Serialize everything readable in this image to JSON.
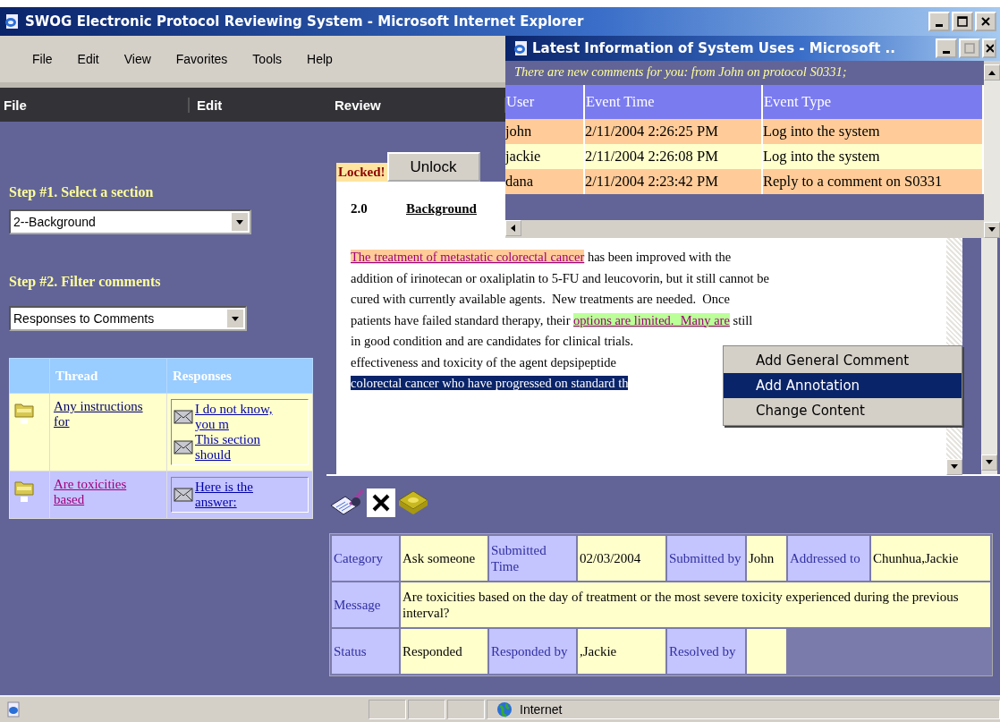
{
  "window": {
    "title": "SWOG Electronic Protocol Reviewing System - Microsoft Internet Explorer"
  },
  "menu_bar": [
    "File",
    "Edit",
    "View",
    "Favorites",
    "Tools",
    "Help"
  ],
  "app_menu": [
    "File",
    "Edit",
    "Review"
  ],
  "left_panel": {
    "step1_label": "Step #1. Select a section",
    "section_select": "2--Background",
    "step2_label": "Step #2. Filter comments",
    "filter_select": "Responses to Comments"
  },
  "thread_table": {
    "columns": [
      "Thread",
      "Responses"
    ],
    "rows": [
      {
        "thread": "Any instructions for",
        "selected": false,
        "responses": [
          "I do not know, you m",
          "This section should"
        ]
      },
      {
        "thread": "Are toxicities based",
        "selected": true,
        "responses": [
          "Here is the answer:"
        ]
      }
    ]
  },
  "document": {
    "lock_status": "Locked!",
    "unlock_button": "Unlock",
    "section_number": "2.0",
    "section_title": "Background",
    "lines": [
      [
        {
          "text": "The treatment of metastatic colorectal cancer",
          "kind": "annotation"
        },
        {
          "text": " has been improved with the",
          "kind": "plain"
        }
      ],
      [
        {
          "text": "addition of irinotecan or oxaliplatin to 5-FU and leucovorin, but it still cannot be",
          "kind": "plain"
        }
      ],
      [
        {
          "text": "cured with currently available agents.  New treatments are needed.  Once",
          "kind": "plain"
        }
      ],
      [
        {
          "text": "patients have failed standard therapy, their ",
          "kind": "plain"
        },
        {
          "text": "options are limited.  Many are",
          "kind": "comment"
        },
        {
          "text": " still",
          "kind": "plain"
        }
      ],
      [
        {
          "text": "in good condition and are candidates for clinical trials.",
          "kind": "plain"
        }
      ],
      [
        {
          "text": "effectiveness and toxicity of the agent depsipeptide",
          "kind": "plain"
        }
      ],
      [
        {
          "text": "colorectal cancer who have progressed on standard th",
          "kind": "selected"
        }
      ]
    ]
  },
  "comment_details": {
    "rows": [
      [
        {
          "kind": "label",
          "text": "Category"
        },
        {
          "kind": "value",
          "text": "Ask someone"
        },
        {
          "kind": "label",
          "text": "Submitted Time"
        },
        {
          "kind": "value",
          "text": "02/03/2004"
        },
        {
          "kind": "label",
          "text": "Submitted by"
        },
        {
          "kind": "value",
          "text": "John"
        },
        {
          "kind": "label",
          "text": "Addressed to"
        },
        {
          "kind": "value",
          "text": "Chunhua,Jackie"
        }
      ],
      [
        {
          "kind": "label",
          "text": "Message"
        },
        {
          "kind": "wide",
          "colspan": 7,
          "text": "Are toxicities based on the day of treatment or the most severe toxicity experienced during the previous interval?"
        }
      ],
      [
        {
          "kind": "label",
          "text": "Status"
        },
        {
          "kind": "value",
          "text": "Responded"
        },
        {
          "kind": "label",
          "text": "Responded by"
        },
        {
          "kind": "value",
          "text": ",Jackie"
        },
        {
          "kind": "label",
          "text": "Resolved by"
        },
        {
          "kind": "blank"
        }
      ]
    ]
  },
  "popup": {
    "title": "Latest Information of System Uses - Microsoft ..",
    "notice": "There are new comments for you: from John on protocol S0331;",
    "columns": [
      "User",
      "Event Time",
      "Event Type"
    ],
    "rows": [
      {
        "user": "john",
        "time": "2/11/2004 2:26:25 PM",
        "event": "Log into the system"
      },
      {
        "user": "jackie",
        "time": "2/11/2004 2:26:08 PM",
        "event": "Log into the system"
      },
      {
        "user": "dana",
        "time": "2/11/2004 2:23:42 PM",
        "event": "Reply to a comment on S0331"
      }
    ]
  },
  "context_menu": [
    {
      "label": "Add General Comment",
      "selected": false
    },
    {
      "label": "Add Annotation",
      "selected": true
    },
    {
      "label": "Change Content",
      "selected": false
    }
  ],
  "status_bar": {
    "zone": "Internet"
  }
}
